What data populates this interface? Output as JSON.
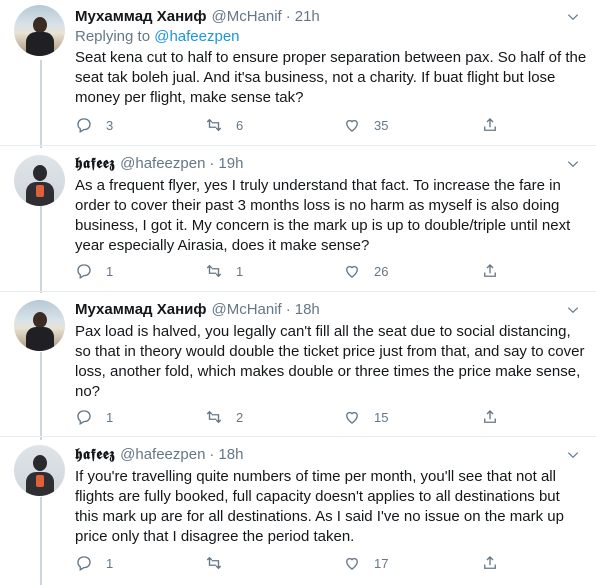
{
  "tweets": [
    {
      "author": "Мухаммад Ханиф",
      "handle": "@McHanif",
      "time": "21h",
      "reply_prefix": "Replying to ",
      "reply_to": "@hafeezpen",
      "text": "Seat kena cut to half to ensure proper separation between pax. So half of the seat tak boleh jual. And it'sa business, not a charity. If buat flight but lose money per flight, make sense tak?",
      "replies": "3",
      "retweets": "6",
      "likes": "35"
    },
    {
      "author": "𝖍𝖆𝖋𝖊𝖊𝖟",
      "handle": "@hafeezpen",
      "time": "19h",
      "text": "As a frequent flyer, yes I truly understand that fact. To increase the fare in order to cover their past 3 months loss is no harm as myself is also doing business, I got it. My concern is the mark up is up to double/triple until next year especially Airasia, does it make sense?",
      "replies": "1",
      "retweets": "1",
      "likes": "26"
    },
    {
      "author": "Мухаммад Ханиф",
      "handle": "@McHanif",
      "time": "18h",
      "text": "Pax load is halved, you legally can't fill all the seat due to social distancing, so that in theory would double the ticket price just from that, and say to cover loss, another fold, which makes double or three times the price make sense, no?",
      "replies": "1",
      "retweets": "2",
      "likes": "15"
    },
    {
      "author": "𝖍𝖆𝖋𝖊𝖊𝖟",
      "handle": "@hafeezpen",
      "time": "18h",
      "text": "If you're travelling quite numbers of time per month, you'll see that not all flights are fully booked, full capacity doesn't applies to all destinations but this mark up are for all destinations. As I said I've no issue on the mark up price only that I disagree the period taken.",
      "replies": "1",
      "retweets": "",
      "likes": "17"
    }
  ],
  "icons": {
    "reply": "reply-icon",
    "retweet": "retweet-icon",
    "like": "heart-icon",
    "share": "share-icon",
    "menu": "chevron-down-icon"
  },
  "colors": {
    "text": "#14171a",
    "muted": "#657786",
    "link": "#1b95e0",
    "divider": "#e6ecf0"
  }
}
